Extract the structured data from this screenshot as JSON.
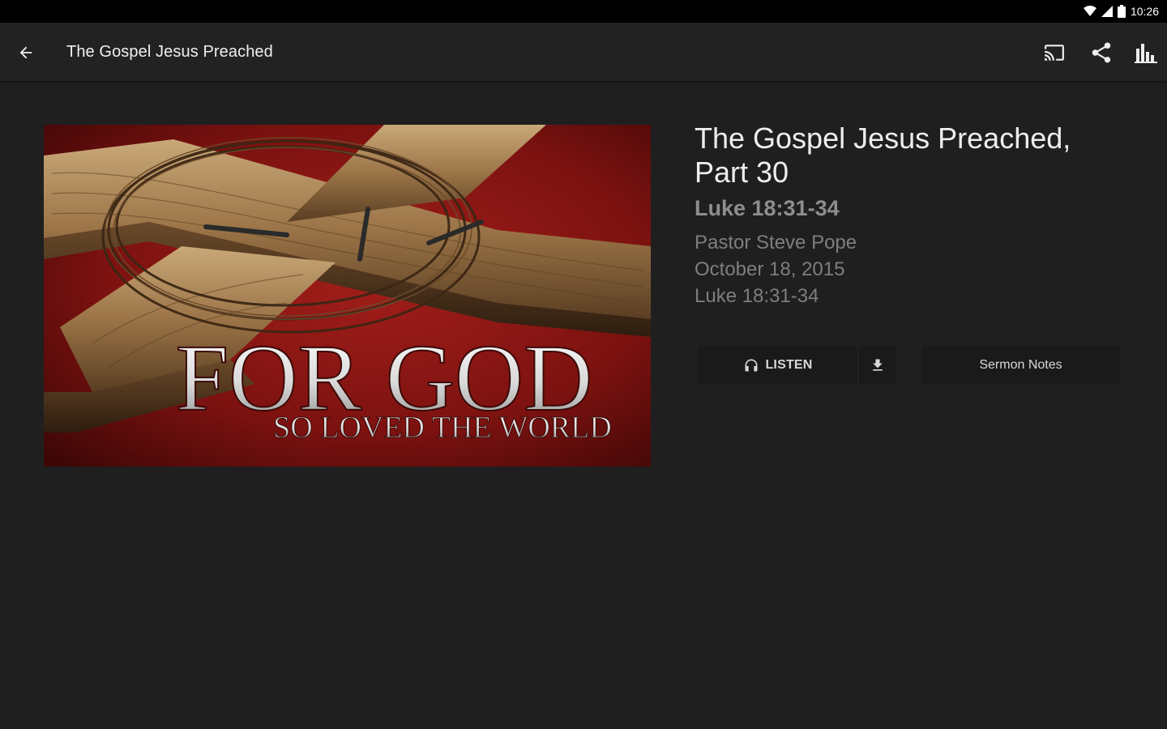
{
  "status_bar": {
    "time": "10:26"
  },
  "app_bar": {
    "title": "The Gospel Jesus Preached",
    "icons": [
      "back-arrow-icon",
      "cast-icon",
      "share-icon",
      "stats-icon"
    ]
  },
  "artwork": {
    "line1": "FOR GOD",
    "line2": "SO LOVED THE WORLD"
  },
  "sermon": {
    "title": "The Gospel Jesus Preached, Part 30",
    "scripture": "Luke 18:31-34",
    "speaker": "Pastor Steve Pope",
    "date": "October 18, 2015",
    "passage": "Luke 18:31-34"
  },
  "actions": {
    "listen_label": "LISTEN",
    "notes_label": "Sermon Notes"
  },
  "colors": {
    "background": "#1f1f20",
    "app_bar": "#222223",
    "button_bg": "#1a1a1a",
    "artwork_red": "#8a1414"
  }
}
